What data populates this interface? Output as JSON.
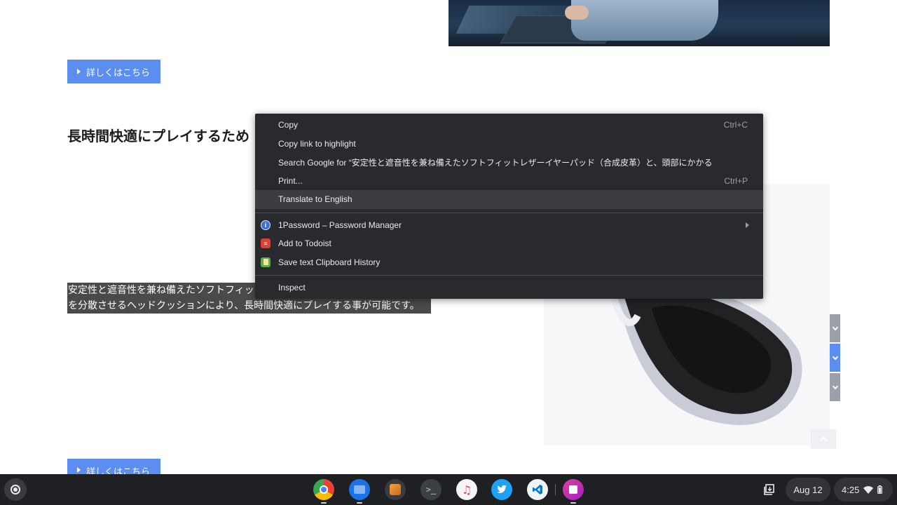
{
  "page": {
    "more_button_label": "詳しくはこちら",
    "section_heading": "長時間快適にプレイするため",
    "selected_text_line1": "安定性と遮音性を兼ね備えたソフトフィットレザーイヤーパッド",
    "selected_text_line2": "を分散させるヘッドクッションにより、長時間快適にプレイする事が可能です。"
  },
  "context_menu": {
    "items": [
      {
        "label": "Copy",
        "shortcut": "Ctrl+C"
      },
      {
        "label": "Copy link to highlight"
      },
      {
        "label": "Search Google for “安定性と遮音性を兼ね備えたソフトフィットレザーイヤーパッド（合成皮革）と、頭部にかかる圧力を分散"
      },
      {
        "label": "Print...",
        "shortcut": "Ctrl+P"
      },
      {
        "label": "Translate to English"
      }
    ],
    "extension_items": [
      {
        "label": "1Password – Password Manager",
        "icon": "1password-icon"
      },
      {
        "label": "Add to Todoist",
        "icon": "todoist-icon"
      },
      {
        "label": "Save text Clipboard History",
        "icon": "clipboard-history-icon"
      }
    ],
    "inspect_label": "Inspect"
  },
  "shelf": {
    "apps": [
      "chrome-icon",
      "files-icon",
      "sketch-icon",
      "terminal-icon",
      "music-icon",
      "twitter-icon",
      "vscode-icon",
      "screen-recorder-icon"
    ],
    "date": "Aug 12",
    "time": "4:25"
  },
  "colors": {
    "accent_button": "#5b8ef0",
    "menu_bg": "#292a2d",
    "shelf_bg": "#1f2023",
    "selection": "#4a4a4a"
  }
}
